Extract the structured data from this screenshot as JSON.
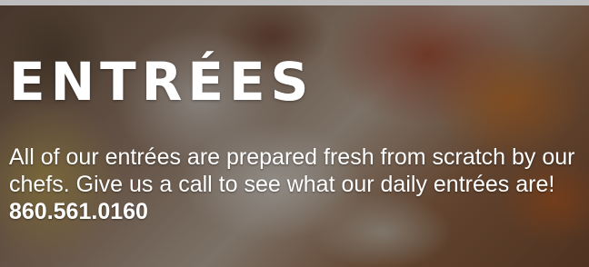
{
  "section": {
    "title": "ENTRÉES",
    "description": "All of our entrées are prepared fresh from scratch by our chefs. Give us a call to see what our daily entrées are!",
    "phone": "860.561.0160"
  },
  "background_image": "grilled sliced chicken breast with roasted vegetables",
  "colors": {
    "text": "#ffffff",
    "overlay": "rgba(20,16,14,0.42)"
  }
}
